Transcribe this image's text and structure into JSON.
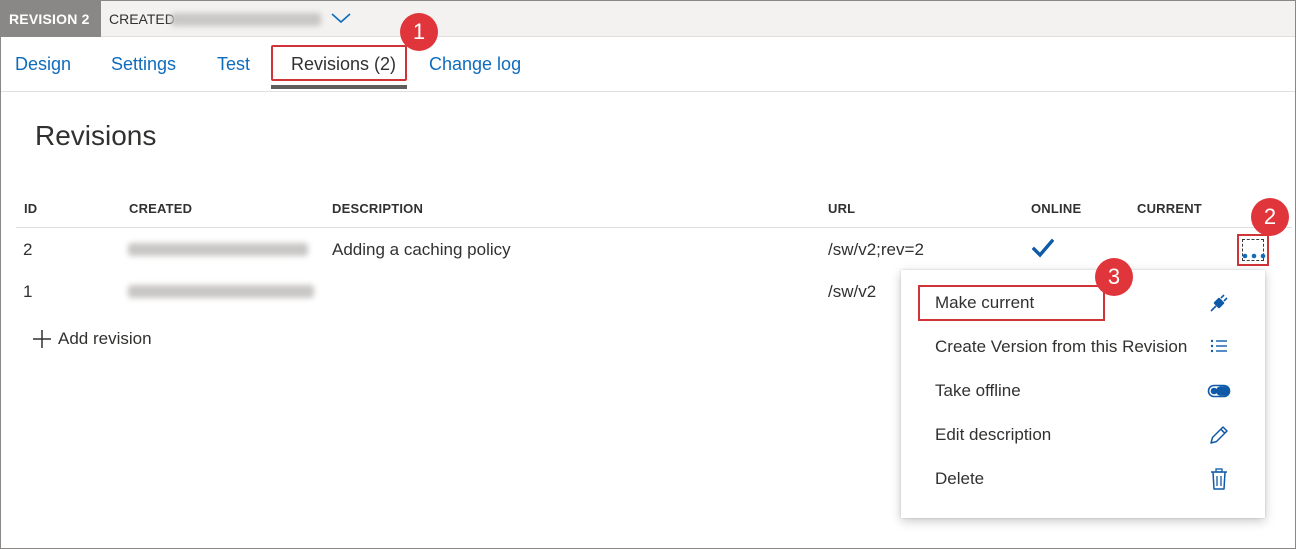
{
  "topbar": {
    "revision_badge": "REVISION 2",
    "created_label": "CREATED"
  },
  "tabs": [
    {
      "label": "Design"
    },
    {
      "label": "Settings"
    },
    {
      "label": "Test"
    },
    {
      "label": "Revisions (2)",
      "active": true
    },
    {
      "label": "Change log"
    }
  ],
  "callouts": [
    "1",
    "2",
    "3"
  ],
  "page": {
    "title": "Revisions"
  },
  "table": {
    "columns": [
      "ID",
      "CREATED",
      "DESCRIPTION",
      "URL",
      "ONLINE",
      "CURRENT"
    ],
    "rows": [
      {
        "id": "2",
        "description": "Adding a caching policy",
        "url": "/sw/v2;rev=2",
        "online": true
      },
      {
        "id": "1",
        "description": "",
        "url": "/sw/v2",
        "online": false
      }
    ]
  },
  "add_revision": {
    "label": "Add revision"
  },
  "context_menu": {
    "items": [
      {
        "label": "Make current",
        "icon": "plug-icon"
      },
      {
        "label": "Create Version from this Revision",
        "icon": "list-icon"
      },
      {
        "label": "Take offline",
        "icon": "toggle-icon"
      },
      {
        "label": "Edit description",
        "icon": "pencil-icon"
      },
      {
        "label": "Delete",
        "icon": "trash-icon"
      }
    ]
  },
  "colors": {
    "accent": "#0f6cbd",
    "callout": "#e0363b",
    "highlight_border": "#d13438",
    "badge_bg": "#8a8886"
  }
}
